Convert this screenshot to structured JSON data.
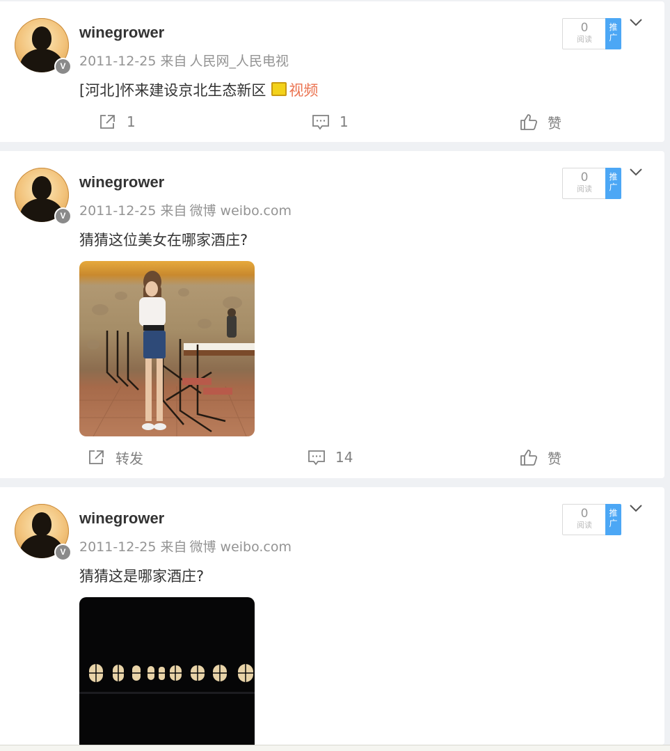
{
  "posts": [
    {
      "username": "winegrower",
      "verified_badge": "V",
      "date": "2011-12-25",
      "source_prefix": "来自",
      "source": "人民网_人民电视",
      "text": "[河北]怀来建设京北生态新区",
      "video_label": "视频",
      "read_count": "0",
      "read_label": "阅读",
      "promo_label_1": "推",
      "promo_label_2": "广",
      "repost": "1",
      "comment": "1",
      "like": "赞",
      "has_image": false
    },
    {
      "username": "winegrower",
      "verified_badge": "V",
      "date": "2011-12-25",
      "source_prefix": "来自",
      "source": "微博 weibo.com",
      "text": "猜猜这位美女在哪家酒庄?",
      "read_count": "0",
      "read_label": "阅读",
      "promo_label_1": "推",
      "promo_label_2": "广",
      "repost": "转发",
      "comment": "14",
      "like": "赞",
      "has_image": true
    },
    {
      "username": "winegrower",
      "verified_badge": "V",
      "date": "2011-12-25",
      "source_prefix": "来自",
      "source": "微博 weibo.com",
      "text": "猜猜这是哪家酒庄?",
      "read_count": "0",
      "read_label": "阅读",
      "promo_label_1": "推",
      "promo_label_2": "广",
      "has_image": true
    }
  ],
  "icons": {
    "repost": "repost-icon",
    "comment": "comment-icon",
    "like": "thumbs-up-icon",
    "menu": "chevron-down-icon",
    "video": "video-icon"
  },
  "colors": {
    "accent_blue": "#4ca7f5",
    "link_orange": "#eb7350",
    "background": "#eff1f4"
  }
}
